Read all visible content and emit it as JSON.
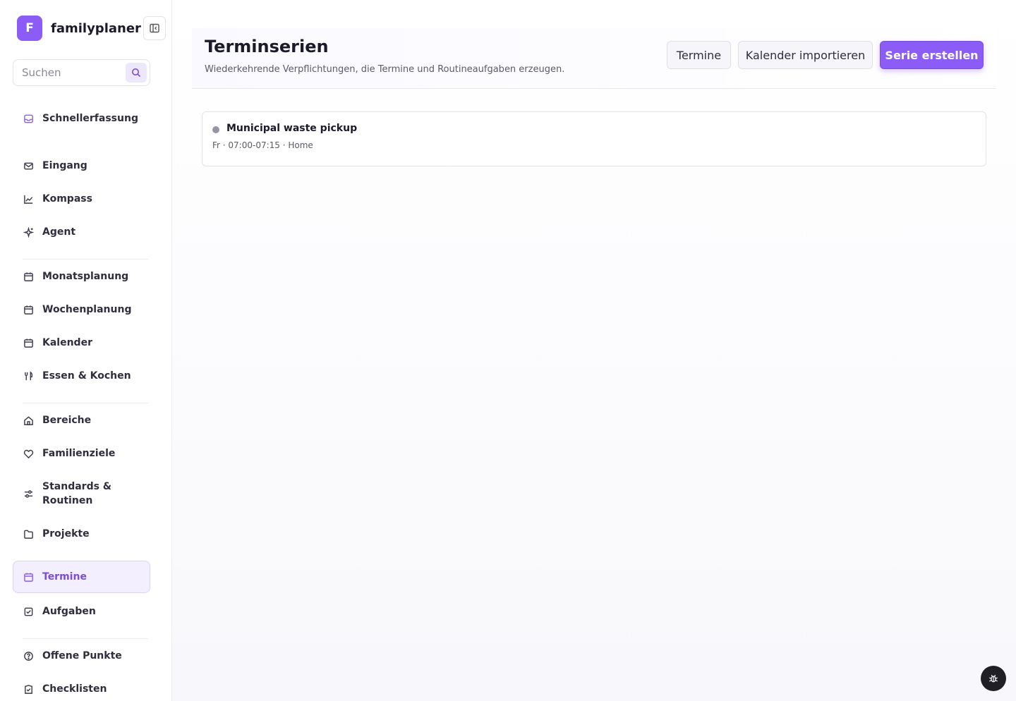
{
  "app": {
    "logo_letter": "F",
    "name": "familyplaner"
  },
  "search": {
    "placeholder": "Suchen"
  },
  "sidebar": {
    "items": [
      {
        "label": "Schnellerfassung",
        "icon": "inbox-icon"
      },
      {
        "label": "Eingang",
        "icon": "mail-icon"
      },
      {
        "label": "Kompass",
        "icon": "chart-line-icon"
      },
      {
        "label": "Agent",
        "icon": "sparkles-icon"
      },
      {
        "label": "Monatsplanung",
        "icon": "calendar-icon"
      },
      {
        "label": "Wochenplanung",
        "icon": "calendar-icon"
      },
      {
        "label": "Kalender",
        "icon": "calendar-icon"
      },
      {
        "label": "Essen & Kochen",
        "icon": "utensils-icon"
      },
      {
        "label": "Bereiche",
        "icon": "home-icon"
      },
      {
        "label": "Familienziele",
        "icon": "heart-icon"
      },
      {
        "label": "Standards & Routinen",
        "icon": "sliders-icon"
      },
      {
        "label": "Projekte",
        "icon": "folder-icon"
      },
      {
        "label": "Termine",
        "icon": "calendar-icon",
        "active": true
      },
      {
        "label": "Aufgaben",
        "icon": "check-square-icon"
      },
      {
        "label": "Offene Punkte",
        "icon": "help-circle-icon"
      },
      {
        "label": "Checklisten",
        "icon": "checklist-icon"
      }
    ]
  },
  "header": {
    "title": "Terminserien",
    "subtitle": "Wiederkehrende Verpflichtungen, die Termine und Routineaufgaben erzeugen.",
    "buttons": {
      "termine": "Termine",
      "import": "Kalender importieren",
      "create": "Serie erstellen"
    }
  },
  "series": [
    {
      "title": "Municipal waste pickup",
      "meta": "Fr · 07:00-07:15 · Home"
    }
  ],
  "colors": {
    "accent": "#8b5cf6",
    "accent_text": "#7c4ddb"
  }
}
